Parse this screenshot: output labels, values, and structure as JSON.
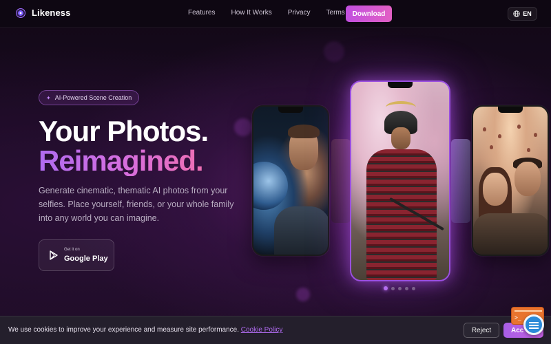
{
  "nav": {
    "brand": "Likeness",
    "links": [
      "Features",
      "How It Works",
      "Privacy",
      "Terms"
    ],
    "download_label": "Download",
    "language": "EN"
  },
  "hero": {
    "badge": "AI-Powered Scene Creation",
    "title_line1": "Your Photos.",
    "title_line2": "Reimagined.",
    "description": "Generate cinematic, thematic AI photos from your selfies. Place yourself, friends, or your whole family into any world you can imagine.",
    "store_small": "Get it on",
    "store_big": "Google Play"
  },
  "carousel": {
    "slide_count": 5,
    "active_index": 0
  },
  "cookie": {
    "text": "We use cookies to improve your experience and measure site performance.",
    "link_label": "Cookie Policy",
    "reject_label": "Reject",
    "accept_label": "Acc"
  },
  "colors": {
    "accent": "#b46ef0",
    "accent_pink": "#e25fc4",
    "background": "#1a0b22"
  },
  "icons": {
    "brand": "likeness-logo-icon",
    "language": "globe-icon",
    "store": "google-play-icon",
    "badge": "sparkle-icon"
  }
}
